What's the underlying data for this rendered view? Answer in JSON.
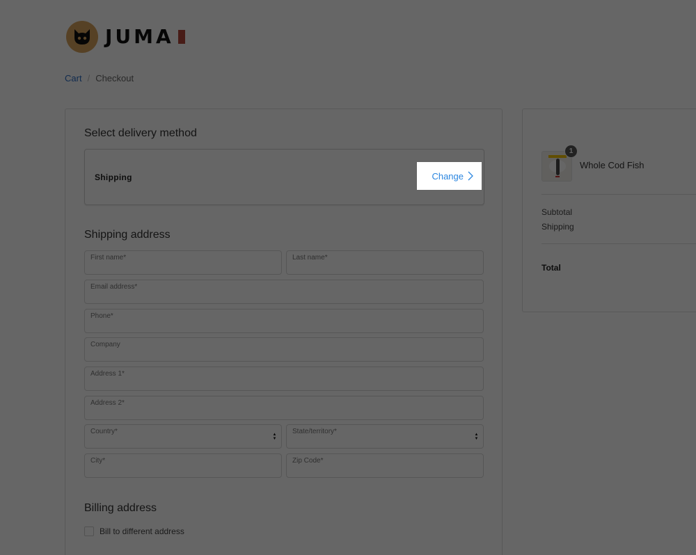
{
  "brand": {
    "name": "JUMA",
    "logo_icon": "cat-icon",
    "logo_color": "#d8a25c",
    "seal_color": "#b5483a"
  },
  "breadcrumb": {
    "items": [
      {
        "label": "Cart",
        "link": true
      },
      {
        "label": "Checkout",
        "link": false
      }
    ],
    "separator": "/"
  },
  "delivery": {
    "title": "Select delivery method",
    "method": "Shipping",
    "change_label": "Change",
    "change_icon": "chevron-right-icon",
    "accent_color": "#2b86e0"
  },
  "shipping_address": {
    "title": "Shipping address",
    "fields": {
      "first_name": {
        "label": "First name*",
        "value": ""
      },
      "last_name": {
        "label": "Last name*",
        "value": ""
      },
      "email": {
        "label": "Email address*",
        "value": ""
      },
      "phone": {
        "label": "Phone*",
        "value": ""
      },
      "company": {
        "label": "Company",
        "value": ""
      },
      "address1": {
        "label": "Address 1*",
        "value": ""
      },
      "address2": {
        "label": "Address 2*",
        "value": ""
      },
      "country": {
        "label": "Country*",
        "value": ""
      },
      "state": {
        "label": "State/territory*",
        "value": ""
      },
      "city": {
        "label": "City*",
        "value": ""
      },
      "zip": {
        "label": "Zip Code*",
        "value": ""
      }
    }
  },
  "billing": {
    "title": "Billing address",
    "checkbox_label": "Bill to different address",
    "checked": false
  },
  "summary": {
    "items": [
      {
        "name": "Whole Cod Fish",
        "quantity": "1"
      }
    ],
    "subtotal_label": "Subtotal",
    "shipping_label": "Shipping",
    "total_label": "Total"
  },
  "overlay": {
    "active": true,
    "highlighted": "Change"
  }
}
